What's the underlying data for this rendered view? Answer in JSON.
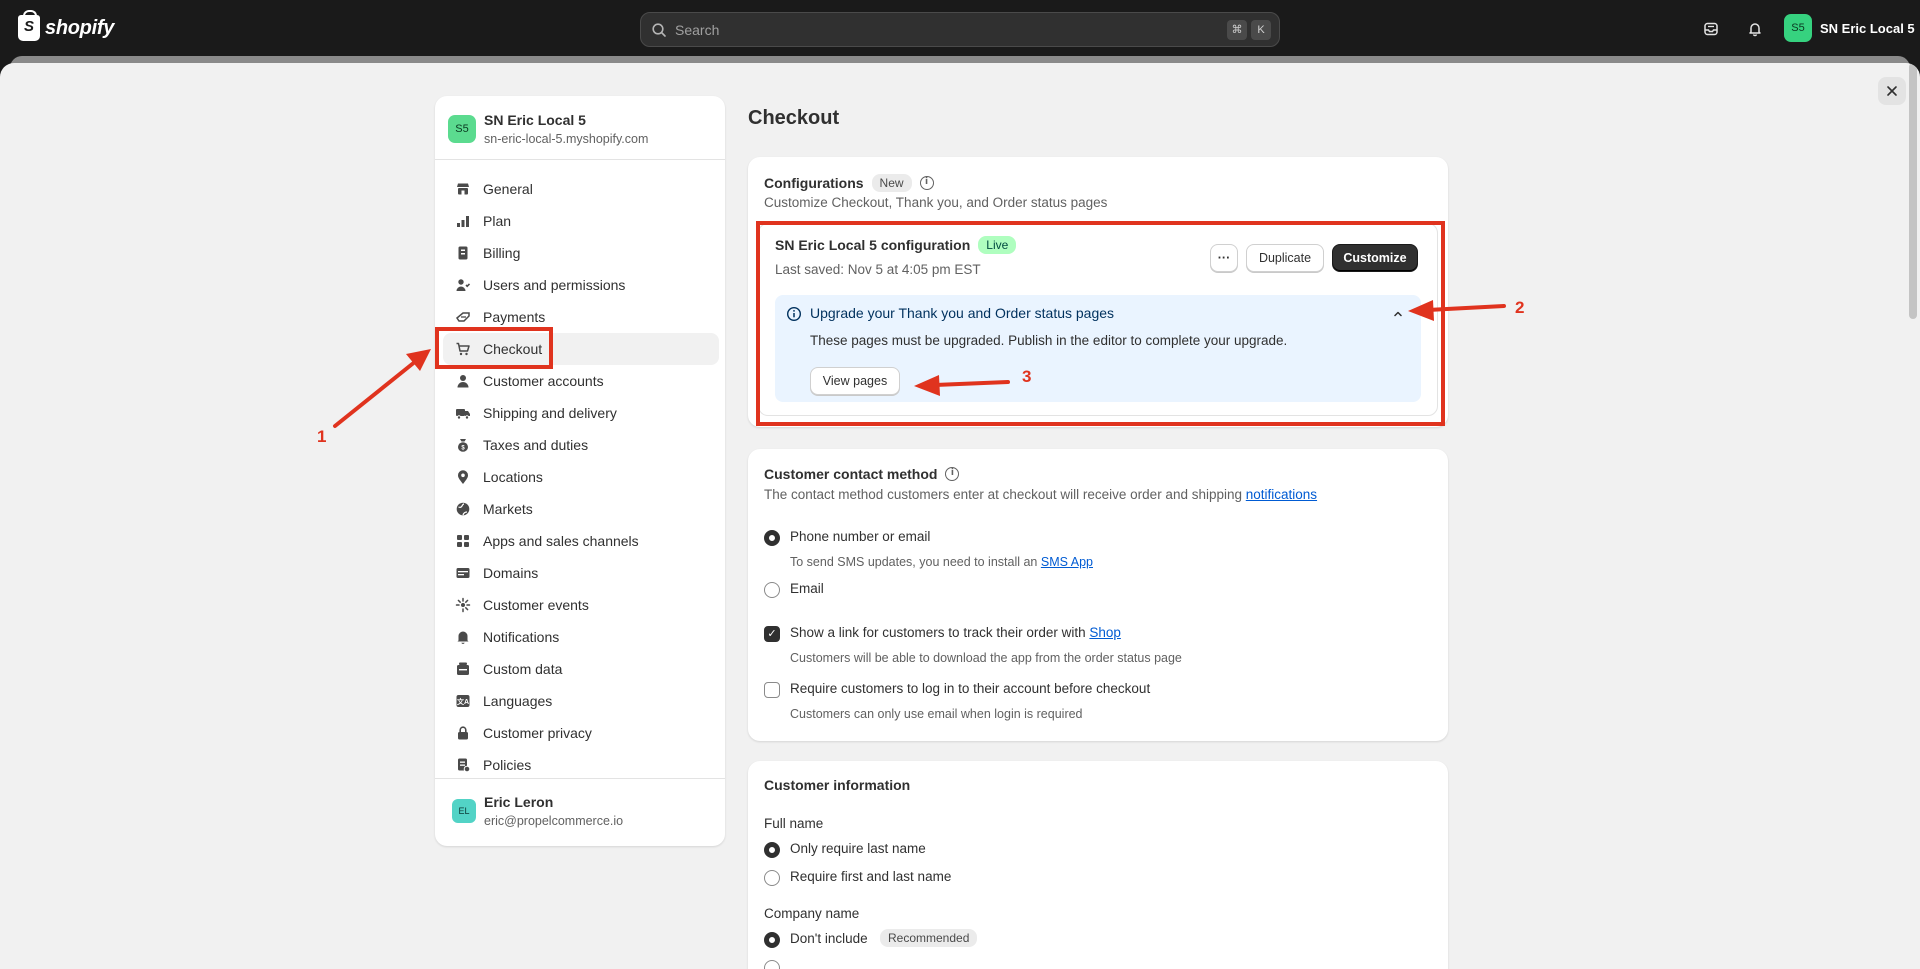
{
  "topbar": {
    "logo_text": "shopify",
    "search_placeholder": "Search",
    "shortcut_keys": [
      "⌘",
      "K"
    ],
    "store_avatar": "S5",
    "store_label": "SN Eric Local 5"
  },
  "sidebar": {
    "store_avatar": "S5",
    "store_name": "SN Eric Local 5",
    "store_domain": "sn-eric-local-5.myshopify.com",
    "items": [
      {
        "label": "General",
        "icon": "store-icon"
      },
      {
        "label": "Plan",
        "icon": "plan-icon"
      },
      {
        "label": "Billing",
        "icon": "billing-icon"
      },
      {
        "label": "Users and permissions",
        "icon": "users-icon"
      },
      {
        "label": "Payments",
        "icon": "payments-icon"
      },
      {
        "label": "Checkout",
        "icon": "cart-icon",
        "active": true
      },
      {
        "label": "Customer accounts",
        "icon": "person-icon"
      },
      {
        "label": "Shipping and delivery",
        "icon": "truck-icon"
      },
      {
        "label": "Taxes and duties",
        "icon": "tax-icon"
      },
      {
        "label": "Locations",
        "icon": "location-icon"
      },
      {
        "label": "Markets",
        "icon": "globe-icon"
      },
      {
        "label": "Apps and sales channels",
        "icon": "apps-icon"
      },
      {
        "label": "Domains",
        "icon": "domains-icon"
      },
      {
        "label": "Customer events",
        "icon": "events-icon"
      },
      {
        "label": "Notifications",
        "icon": "bell-icon"
      },
      {
        "label": "Custom data",
        "icon": "custom-data-icon"
      },
      {
        "label": "Languages",
        "icon": "language-icon"
      },
      {
        "label": "Customer privacy",
        "icon": "lock-icon"
      },
      {
        "label": "Policies",
        "icon": "policies-icon"
      }
    ],
    "user_avatar": "EL",
    "user_name": "Eric Leron",
    "user_email": "eric@propelcommerce.io"
  },
  "main": {
    "title": "Checkout",
    "configurations": {
      "title": "Configurations",
      "badge": "New",
      "subtitle": "Customize Checkout, Thank you, and Order status pages",
      "config_name": "SN Eric Local 5 configuration",
      "status": "Live",
      "last_saved": "Last saved: Nov 5 at 4:05 pm EST",
      "more_label": "···",
      "duplicate_label": "Duplicate",
      "customize_label": "Customize",
      "banner_title": "Upgrade your Thank you and Order status pages",
      "banner_body": "These pages must be upgraded. Publish in the editor to complete your upgrade.",
      "view_pages_label": "View pages"
    },
    "contact": {
      "title": "Customer contact method",
      "desc_prefix": "The contact method customers enter at checkout will receive order and shipping",
      "desc_link": "notifications",
      "option_phone": "Phone number or email",
      "option_phone_help_prefix": "To send SMS updates, you need to install an",
      "option_phone_help_link": "SMS App",
      "option_email": "Email",
      "track_label_prefix": "Show a link for customers to track their order with",
      "track_link": "Shop",
      "track_help": "Customers will be able to download the app from the order status page",
      "login_label": "Require customers to log in to their account before checkout",
      "login_help": "Customers can only use email when login is required"
    },
    "info": {
      "title": "Customer information",
      "full_name_label": "Full name",
      "full_name_opt1": "Only require last name",
      "full_name_opt2": "Require first and last name",
      "company_label": "Company name",
      "company_opt1": "Don't include",
      "company_badge": "Recommended"
    }
  },
  "annotations": {
    "n1": "1",
    "n2": "2",
    "n3": "3",
    "color": "#e0331e"
  }
}
